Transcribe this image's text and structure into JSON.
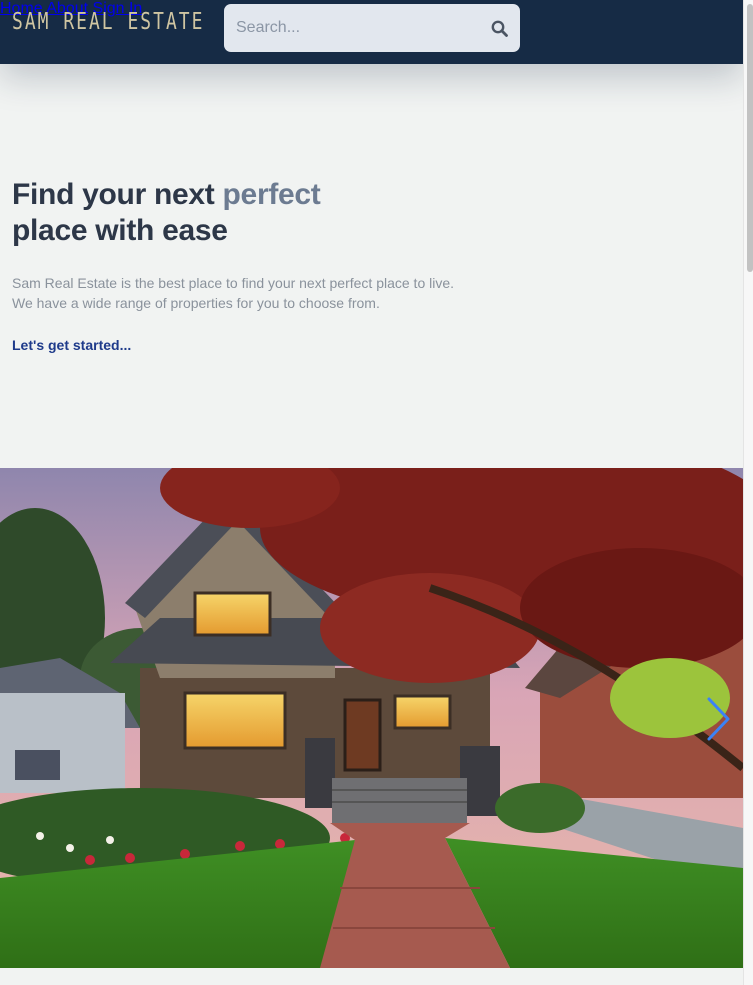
{
  "header": {
    "logo_text": "SAM REAL ESTATE",
    "search": {
      "placeholder": "Search...",
      "value": ""
    },
    "nav": [
      {
        "label": "Home"
      },
      {
        "label": "About"
      },
      {
        "label": "Sign In"
      }
    ]
  },
  "hero": {
    "title_part1": "Find your next",
    "title_accent": "perfect",
    "title_part2": "place with ease",
    "description_line1": "Sam Real Estate is the best place to find your next perfect place to live.",
    "description_line2": "We have a wide range of properties for you to choose from.",
    "cta_label": "Let's get started..."
  },
  "slider": {
    "image_subject": "craftsman-house-photo",
    "next_icon": "chevron-right-icon"
  },
  "colors": {
    "header_bg": "#162b45",
    "logo": "#cfc5a2",
    "title": "#2d3748",
    "title_accent": "#6c7b91",
    "cta": "#1e3a8a",
    "arrow": "#3b82f6",
    "page_bg": "#f1f3f2"
  }
}
